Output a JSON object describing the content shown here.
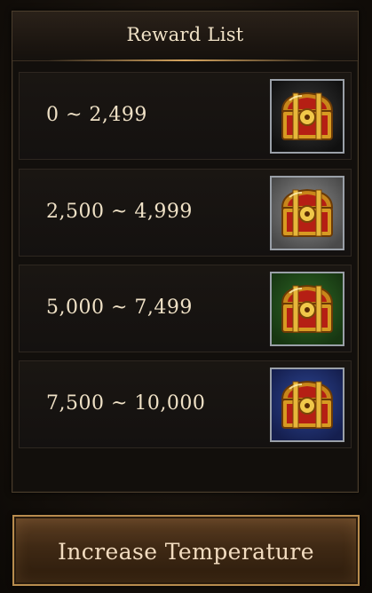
{
  "panel": {
    "title": "Reward List"
  },
  "rewards": [
    {
      "range": "0 ~ 2,499",
      "icon": "treasure-chest-icon",
      "frame_color": "#111111"
    },
    {
      "range": "2,500 ~ 4,999",
      "icon": "treasure-chest-icon",
      "frame_color": "#6e6e6e"
    },
    {
      "range": "5,000 ~ 7,499",
      "icon": "treasure-chest-icon",
      "frame_color": "#24521c"
    },
    {
      "range": "7,500 ~ 10,000",
      "icon": "treasure-chest-icon",
      "frame_color": "#203578"
    }
  ],
  "action": {
    "label": "Increase Temperature"
  },
  "colors": {
    "text": "#efe1c6",
    "accent_gold": "#d8a760",
    "button_border": "#b88c4e"
  }
}
